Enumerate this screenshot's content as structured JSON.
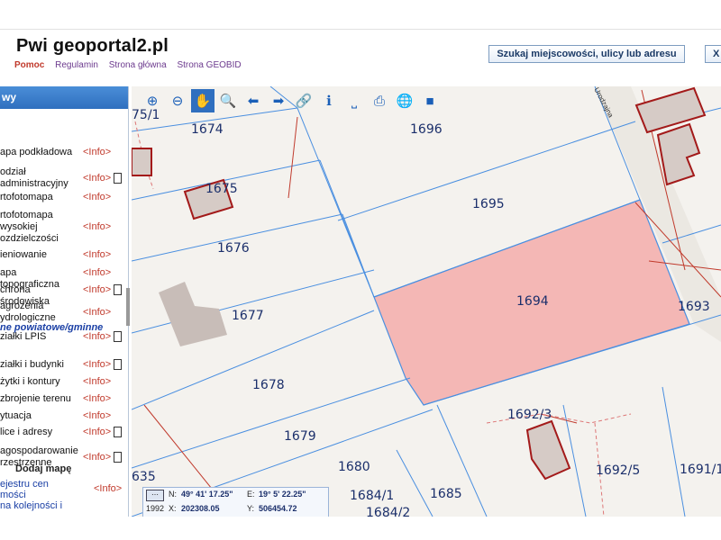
{
  "header": {
    "logo": "geoportal2.pl",
    "logo_prefix": "Pwi",
    "help": "Pomoc",
    "links": [
      "Regulamin",
      "Strona główna",
      "Strona GEOBID"
    ],
    "search_button": "Szukaj miejscowości, ulicy lub adresu",
    "close_button": "X"
  },
  "sidebar": {
    "header": "wy",
    "layers": [
      {
        "label": "apa podkładowa",
        "info": "<Info>",
        "doc": false
      },
      {
        "label": "odział\nadministracyjny",
        "info": "<Info>",
        "doc": true
      },
      {
        "label": "rtofotomapa",
        "info": "<Info>",
        "doc": false
      },
      {
        "label": "rtofotomapa\nwysokiej\nozdzielczości",
        "info": "<Info>",
        "doc": false
      },
      {
        "label": "ieniowanie",
        "info": "<Info>",
        "doc": false
      },
      {
        "label": "apa topograficzna",
        "info": "<Info>",
        "doc": false
      },
      {
        "label": "chrona środowiska",
        "info": "<Info>",
        "doc": true
      },
      {
        "label": "agrożenia\nydrologiczne",
        "info": "<Info>",
        "doc": false
      },
      {
        "label": "ziałki LPIS",
        "info": "<Info>",
        "doc": true
      },
      {
        "label": "ziałki i budynki",
        "info": "<Info>",
        "doc": true
      },
      {
        "label": "żytki i kontury",
        "info": "<Info>",
        "doc": false
      },
      {
        "label": "zbrojenie terenu",
        "info": "<Info>",
        "doc": false
      },
      {
        "label": "ytuacja",
        "info": "<Info>",
        "doc": false
      },
      {
        "label": "lice i adresy",
        "info": "<Info>",
        "doc": true
      },
      {
        "label": "agospodarowanie\nrzestrzenne",
        "info": "<Info>",
        "doc": true
      }
    ],
    "section_label": "ne powiatowe/gminne",
    "add_map": "Dodaj mapę",
    "rejestr": "ejestru cen\nmości",
    "rejestr_info": "<Info>",
    "kolej": "na kolejności i"
  },
  "toolbar": {
    "tools": [
      "zoom-in-icon",
      "zoom-out-icon",
      "pan-hand-icon",
      "zoom-area-icon",
      "arrow-left-icon",
      "arrow-right-icon",
      "link-icon",
      "info-icon",
      "measure-icon",
      "print-icon",
      "globe-icon",
      "video-icon"
    ]
  },
  "map": {
    "street": "Urodzajna",
    "selected_parcel": "1694",
    "parcels": [
      "1674",
      "1696",
      "1675",
      "1695",
      "1676",
      "1694",
      "1677",
      "1693",
      "1678",
      "1679",
      "1692/3",
      "1680",
      "1692/5",
      "1691/1",
      "1684/1",
      "1685",
      "1684/2",
      "635",
      "75/1"
    ]
  },
  "coords": {
    "n_label": "N:",
    "n_value": "49° 41' 17.25\"",
    "e_label": "E:",
    "e_value": "19° 5' 22.25\"",
    "epsg": "1992",
    "x_label": "X:",
    "x_value": "202308.05",
    "y_label": "Y:",
    "y_value": "506454.72"
  },
  "colors": {
    "accent": "#2f6fbf",
    "selected_fill": "#f4b7b5",
    "parcel_line": "#4a8fe0",
    "building_outline": "#a31a1a"
  }
}
